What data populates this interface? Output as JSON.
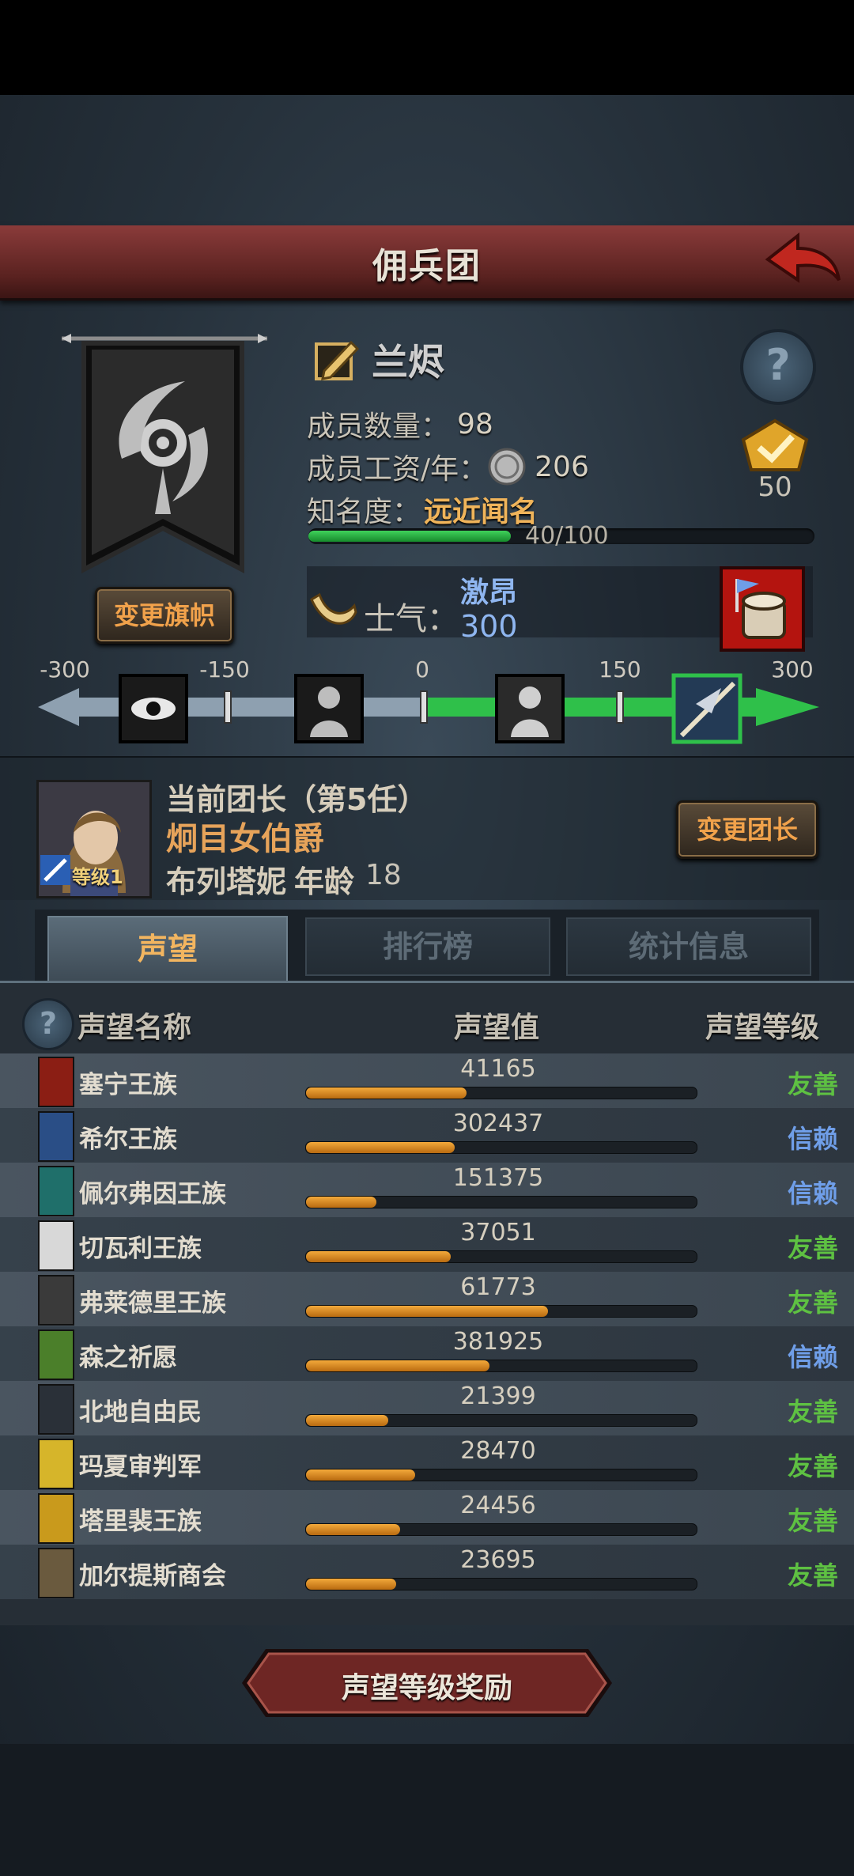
{
  "header": {
    "title": "佣兵团"
  },
  "guild": {
    "name": "兰烬",
    "members_label": "成员数量：",
    "members_value": "98",
    "salary_label": "成员工资/年：",
    "salary_value": "206",
    "fame_label": "知名度：",
    "fame_value": "远近闻名",
    "fame_progress_text": "40/100",
    "fame_progress": 0.4,
    "medal_count": "50",
    "change_banner_label": "变更旗帜",
    "morale_label": "士气：",
    "morale_state": "激昂",
    "morale_value": "300"
  },
  "morale_scale": {
    "ticks": [
      "-300",
      "-150",
      "0",
      "150",
      "300"
    ],
    "current_value": 300,
    "range": [
      -300,
      300
    ]
  },
  "leader": {
    "title": "当前团长（第5任）",
    "rank": "炯目女伯爵",
    "name": "布列塔妮",
    "age_label": "年龄",
    "age": "18",
    "level": "等级1",
    "change_leader_label": "变更团长"
  },
  "tabs": [
    {
      "label": "声望",
      "active": true
    },
    {
      "label": "排行榜",
      "active": false
    },
    {
      "label": "统计信息",
      "active": false
    }
  ],
  "table": {
    "col_name": "声望名称",
    "col_value": "声望值",
    "col_level": "声望等级"
  },
  "reputation": [
    {
      "name": "塞宁王族",
      "value": "41165",
      "level": "友善",
      "progress": 0.41,
      "level_color": "#5ec142",
      "icon": "red-crest-icon",
      "icon_color": "#8b1e14"
    },
    {
      "name": "希尔王族",
      "value": "302437",
      "level": "信赖",
      "progress": 0.38,
      "level_color": "#6f9ee8",
      "icon": "blue-helm-icon",
      "icon_color": "#2a4e86"
    },
    {
      "name": "佩尔弗因王族",
      "value": "151375",
      "level": "信赖",
      "progress": 0.18,
      "level_color": "#6f9ee8",
      "icon": "teal-moon-icon",
      "icon_color": "#1f6f6a"
    },
    {
      "name": "切瓦利王族",
      "value": "37051",
      "level": "友善",
      "progress": 0.37,
      "level_color": "#5ec142",
      "icon": "scales-icon",
      "icon_color": "#d8d8d8"
    },
    {
      "name": "弗莱德里王族",
      "value": "61773",
      "level": "友善",
      "progress": 0.62,
      "level_color": "#5ec142",
      "icon": "dark-dragon-icon",
      "icon_color": "#3a3a3a"
    },
    {
      "name": "森之祈愿",
      "value": "381925",
      "level": "信赖",
      "progress": 0.47,
      "level_color": "#6f9ee8",
      "icon": "tree-icon",
      "icon_color": "#4b7f2a"
    },
    {
      "name": "北地自由民",
      "value": "21399",
      "level": "友善",
      "progress": 0.21,
      "level_color": "#5ec142",
      "icon": "axe-icon",
      "icon_color": "#2a3038"
    },
    {
      "name": "玛夏审判军",
      "value": "28470",
      "level": "友善",
      "progress": 0.28,
      "level_color": "#5ec142",
      "icon": "gold-chevron-icon",
      "icon_color": "#d6b52a"
    },
    {
      "name": "塔里裴王族",
      "value": "24456",
      "level": "友善",
      "progress": 0.24,
      "level_color": "#5ec142",
      "icon": "gold-sun-icon",
      "icon_color": "#c99a1c"
    },
    {
      "name": "加尔提斯商会",
      "value": "23695",
      "level": "友善",
      "progress": 0.23,
      "level_color": "#5ec142",
      "icon": "chest-icon",
      "icon_color": "#6a5a3e"
    }
  ],
  "footer": {
    "reward_label": "声望等级奖励"
  }
}
